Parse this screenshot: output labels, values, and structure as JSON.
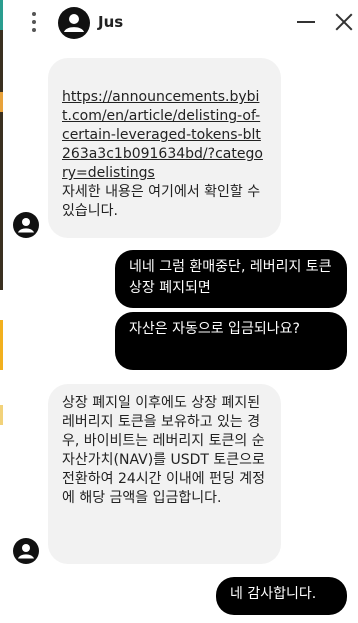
{
  "header": {
    "contact_name": "Jus",
    "avatar_icon": "user-avatar-icon",
    "menu_icon": "kebab-menu-icon",
    "minimize_icon": "minimize-icon",
    "close_icon": "close-icon"
  },
  "messages": [
    {
      "from": "agent",
      "link": "https://announcements.bybit.com/en/article/delisting-of-certain-leveraged-tokens-blt263a3c1b091634bd/?category=delistings",
      "text": "자세한 내용은 여기에서 확인할 수 있습니다."
    },
    {
      "from": "user",
      "text": "네네 그럼 환매중단, 레버리지 토큰 상장 폐지되면"
    },
    {
      "from": "user",
      "text": "자산은 자동으로 입금되나요?"
    },
    {
      "from": "agent",
      "text": "상장 폐지일 이후에도 상장 폐지된 레버리지 토큰을 보유하고 있는 경우, 바이비트는 레버리지 토큰의 순자산가치(NAV)를 USDT 토큰으로 전환하여 24시간 이내에 펀딩 계정에 해당 금액을 입금합니다."
    },
    {
      "from": "user",
      "text": "네 감사합니다."
    }
  ],
  "colors": {
    "incoming_bubble": "#f2f2f2",
    "outgoing_bubble": "#000000",
    "outgoing_text": "#ffffff"
  }
}
